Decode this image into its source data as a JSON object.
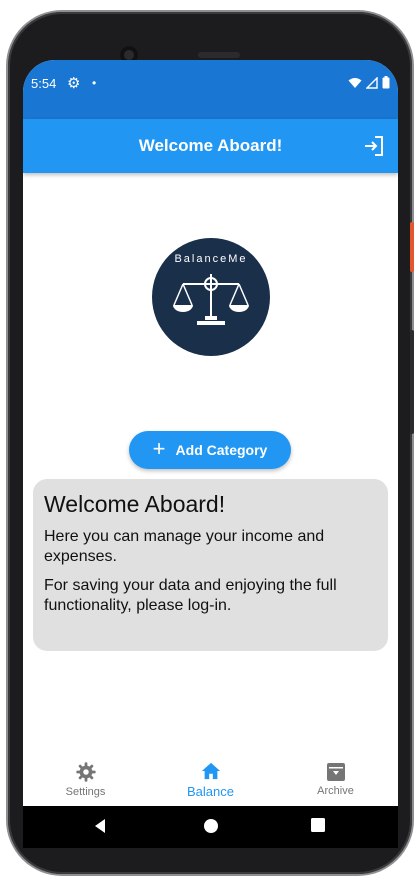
{
  "status_bar": {
    "time": "5:54",
    "dot": "•"
  },
  "app_bar": {
    "title": "Welcome Aboard!"
  },
  "logo": {
    "text": "BalanceMe"
  },
  "add_button": {
    "plus": "+",
    "label": "Add Category"
  },
  "welcome_card": {
    "title": "Welcome Aboard!",
    "line1": "Here you can manage your income and expenses.",
    "line2": "For saving your data and enjoying the full functionality, please log-in."
  },
  "bottom_nav": {
    "items": [
      {
        "label": "Settings",
        "icon": "gear-icon",
        "active": false
      },
      {
        "label": "Balance",
        "icon": "home-icon",
        "active": true
      },
      {
        "label": "Archive",
        "icon": "archive-icon",
        "active": false
      }
    ]
  },
  "colors": {
    "status_bar": "#1976d2",
    "app_bar": "#2196f3",
    "accent": "#2196f3",
    "logo_bg": "#1a2f4a",
    "card_bg": "#e0e0e0"
  }
}
